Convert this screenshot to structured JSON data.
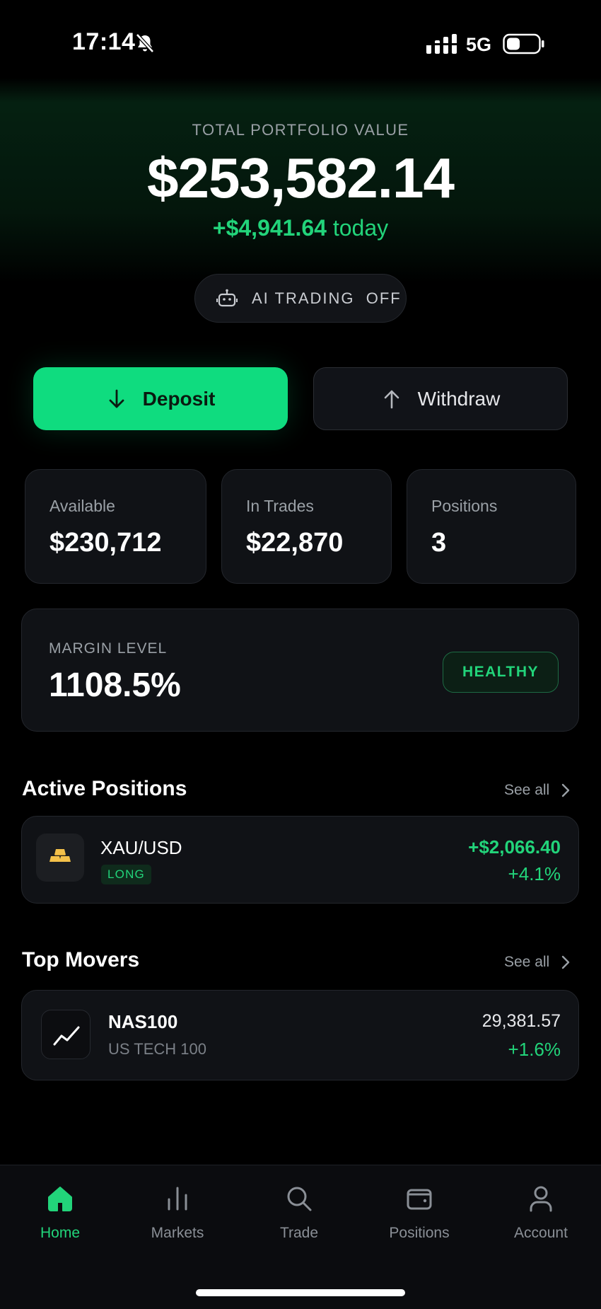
{
  "status_bar": {
    "time": "17:14",
    "network": "5G"
  },
  "portfolio": {
    "label": "TOTAL PORTFOLIO VALUE",
    "value": "$253,582.14",
    "change_amount": "+$4,941.64",
    "change_suffix": "today",
    "ai_trading": "AI TRADING  OFF"
  },
  "actions": {
    "deposit": "Deposit",
    "withdraw": "Withdraw"
  },
  "stats": [
    {
      "label": "Available",
      "value": "$230,712"
    },
    {
      "label": "In Trades",
      "value": "$22,870"
    },
    {
      "label": "Positions",
      "value": "3"
    }
  ],
  "margin": {
    "label": "MARGIN LEVEL",
    "value": "1108.5%",
    "status": "HEALTHY"
  },
  "active_positions": {
    "title": "Active Positions",
    "see_all": "See all",
    "items": [
      {
        "symbol": "XAU/USD",
        "side": "LONG",
        "pnl": "+$2,066.40",
        "pct": "+4.1%"
      }
    ]
  },
  "top_movers": {
    "title": "Top Movers",
    "see_all": "See all",
    "items": [
      {
        "symbol": "NAS100",
        "name": "US TECH 100",
        "price": "29,381.57",
        "pct": "+1.6%"
      }
    ]
  },
  "nav": [
    {
      "label": "Home",
      "icon": "home-icon",
      "active": true
    },
    {
      "label": "Markets",
      "icon": "bar-chart-icon",
      "active": false
    },
    {
      "label": "Trade",
      "icon": "search-icon",
      "active": false
    },
    {
      "label": "Positions",
      "icon": "wallet-icon",
      "active": false
    },
    {
      "label": "Account",
      "icon": "user-icon",
      "active": false
    }
  ],
  "colors": {
    "accent": "#0fdc7f",
    "positive": "#22d47a",
    "background": "#000000",
    "card": "#101216"
  }
}
